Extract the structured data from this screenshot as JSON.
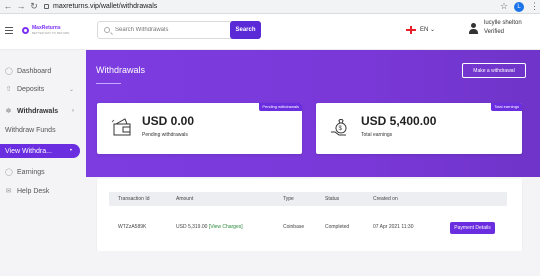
{
  "browser": {
    "url": "maxreturns.vip/wallet/withdrawals",
    "profile_initial": "L"
  },
  "header": {
    "logo_text": "MaxReturns",
    "logo_subtext": "BETTER WAY TO RETURN",
    "search_placeholder": "Search Withdrawals",
    "search_button": "Search",
    "language": "EN",
    "user_name": "lucylle shelton",
    "user_status": "Verified"
  },
  "sidebar": {
    "items": [
      {
        "label": "Dashboard"
      },
      {
        "label": "Deposits"
      },
      {
        "label": "Withdrawals"
      },
      {
        "label": "Withdraw Funds"
      },
      {
        "label": "View Withdra..."
      },
      {
        "label": "Earnings"
      },
      {
        "label": "Help Desk"
      }
    ]
  },
  "page": {
    "title": "Withdrawals",
    "make_withdrawal_button": "Make a withdrawal"
  },
  "stats": [
    {
      "tag": "Pending withdrawals",
      "value": "USD 0.00",
      "label": "Pending withdrawals"
    },
    {
      "tag": "Total earnings",
      "value": "USD 5,400.00",
      "label": "Total earnings"
    }
  ],
  "table": {
    "headers": [
      "Transaction Id",
      "Amount",
      "Type",
      "Status",
      "Created on"
    ],
    "rows": [
      {
        "transaction_id": "WTZzA589K",
        "amount": "USD 5,319.00",
        "charges_link": "[View Charges]",
        "type": "Coinbase",
        "status": "Completed",
        "created_on": "07 Apr 2021 11:30",
        "action": "Payment Details"
      }
    ]
  },
  "colors": {
    "accent": "#6a2de0",
    "banner": "#7c3ce0",
    "charges_link": "#2a8a3a",
    "flag_red": "#e8202a"
  }
}
